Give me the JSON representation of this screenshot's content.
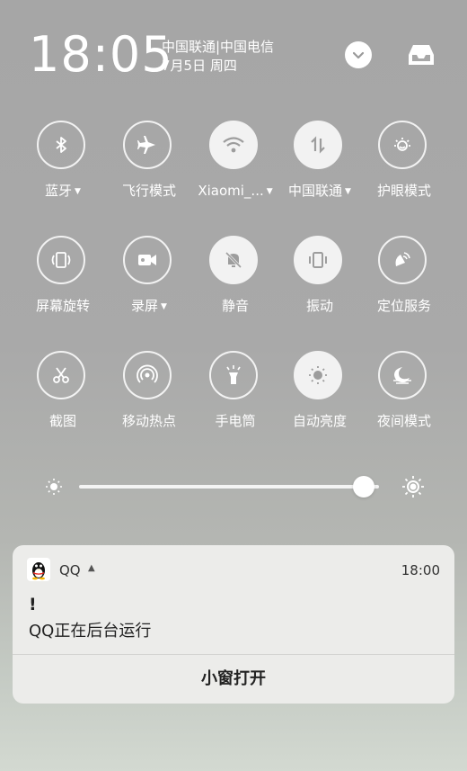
{
  "status": {
    "time": "18:05",
    "carriers": "中国联通|中国电信",
    "date": "7月5日 周四"
  },
  "quick_settings": {
    "rows": [
      [
        {
          "label": "蓝牙",
          "icon": "bluetooth-icon",
          "on": false,
          "has_caret": true
        },
        {
          "label": "飞行模式",
          "icon": "airplane-icon",
          "on": false,
          "has_caret": false
        },
        {
          "label": "Xiaomi_...",
          "icon": "wifi-icon",
          "on": true,
          "has_caret": true
        },
        {
          "label": "中国联通",
          "icon": "mobile-data-icon",
          "on": true,
          "has_caret": true
        },
        {
          "label": "护眼模式",
          "icon": "eye-care-icon",
          "on": false,
          "has_caret": false
        }
      ],
      [
        {
          "label": "屏幕旋转",
          "icon": "rotate-icon",
          "on": false,
          "has_caret": false
        },
        {
          "label": "录屏",
          "icon": "screen-record-icon",
          "on": false,
          "has_caret": true
        },
        {
          "label": "静音",
          "icon": "mute-icon",
          "on": true,
          "has_caret": false
        },
        {
          "label": "振动",
          "icon": "vibrate-icon",
          "on": true,
          "has_caret": false
        },
        {
          "label": "定位服务",
          "icon": "location-icon",
          "on": false,
          "has_caret": false
        }
      ],
      [
        {
          "label": "截图",
          "icon": "screenshot-icon",
          "on": false,
          "has_caret": false
        },
        {
          "label": "移动热点",
          "icon": "hotspot-icon",
          "on": false,
          "has_caret": false
        },
        {
          "label": "手电筒",
          "icon": "flashlight-icon",
          "on": false,
          "has_caret": false
        },
        {
          "label": "自动亮度",
          "icon": "auto-brightness-icon",
          "on": true,
          "has_caret": false
        },
        {
          "label": "夜间模式",
          "icon": "night-mode-icon",
          "on": false,
          "has_caret": false
        }
      ]
    ]
  },
  "brightness": {
    "level": 0.95
  },
  "notification": {
    "app_name": "QQ",
    "time": "18:00",
    "title": "!",
    "body": "QQ正在后台运行",
    "action": "小窗打开"
  }
}
